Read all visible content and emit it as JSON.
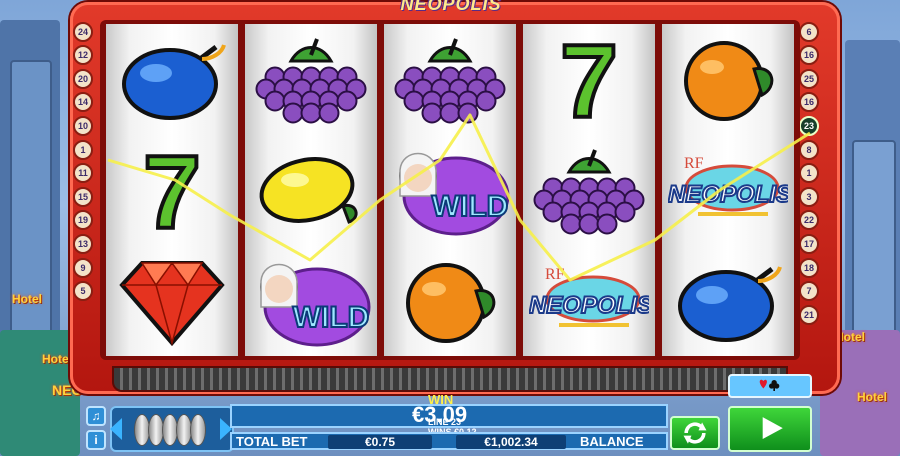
{
  "game": {
    "logo_text": "NEOPOLIS",
    "hotel_signs": [
      "Hotel",
      "Hotel",
      "Hotel",
      "Hotel"
    ],
    "neo_sign": "NEO"
  },
  "reels": [
    [
      "plum",
      "seven",
      "diamond"
    ],
    [
      "grapes",
      "lemon",
      "wild"
    ],
    [
      "grapes",
      "wild",
      "orange"
    ],
    [
      "seven",
      "grapes",
      "neopolis"
    ],
    [
      "orange",
      "neopolis",
      "plum"
    ]
  ],
  "symbol_text": {
    "wild": "WILD",
    "neopolis_main": "NEOPOLIS",
    "neopolis_small": "RF"
  },
  "paylines": {
    "left": [
      "24",
      "12",
      "20",
      "14",
      "10",
      "1",
      "11",
      "15",
      "19",
      "13",
      "9",
      "5"
    ],
    "right": [
      "6",
      "16",
      "25",
      "16",
      "23",
      "8",
      "1",
      "3",
      "22",
      "17",
      "18",
      "7",
      "21"
    ],
    "active": "23"
  },
  "panel": {
    "win_label": "WIN",
    "win_amount": "€3.09",
    "line_label": "LINE 23",
    "wins_label": "WINS €0.12",
    "total_bet_label": "TOTAL BET",
    "total_bet_value": "€0.75",
    "balance_value": "€1,002.34",
    "balance_label": "BALANCE",
    "sound_icon": "music-note-icon",
    "info_icon": "info-icon"
  },
  "colors": {
    "cabinet": "#c91f14",
    "win_line": "#f6f04a",
    "panel_blue": "#1c6ab0",
    "spin_green": "#1fb52a"
  }
}
